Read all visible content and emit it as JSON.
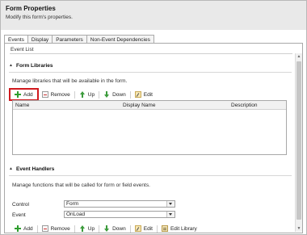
{
  "header": {
    "title": "Form Properties",
    "subtitle": "Modify this form's properties."
  },
  "tabs": [
    {
      "label": "Events",
      "active": true
    },
    {
      "label": "Display",
      "active": false
    },
    {
      "label": "Parameters",
      "active": false
    },
    {
      "label": "Non-Event Dependencies",
      "active": false
    }
  ],
  "event_list_label": "Event List",
  "form_libraries": {
    "title": "Form Libraries",
    "description": "Manage libraries that will be available in the form.",
    "toolbar": {
      "add": "Add",
      "remove": "Remove",
      "up": "Up",
      "down": "Down",
      "edit": "Edit"
    },
    "columns": [
      "Name",
      "Display Name",
      "Description"
    ]
  },
  "event_handlers": {
    "title": "Event Handlers",
    "description": "Manage functions that will be called for form or field events.",
    "control_label": "Control",
    "control_value": "Form",
    "event_label": "Event",
    "event_value": "OnLoad",
    "toolbar": {
      "add": "Add",
      "remove": "Remove",
      "up": "Up",
      "down": "Down",
      "edit": "Edit",
      "edit_library": "Edit Library"
    }
  },
  "colors": {
    "highlight": "#d0191e",
    "add_icon": "#2e9e2e"
  }
}
